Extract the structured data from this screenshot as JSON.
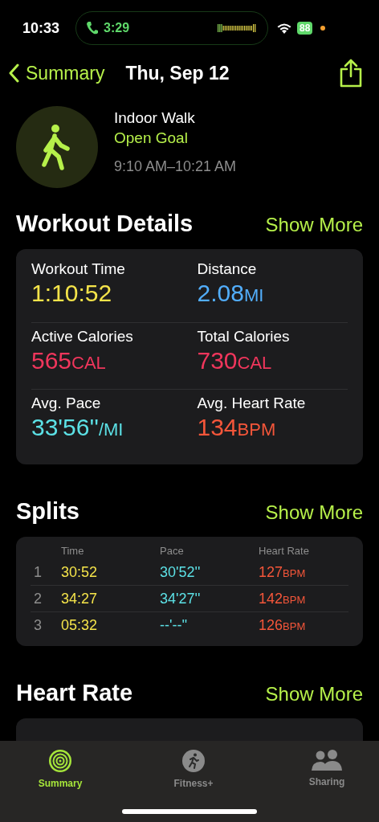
{
  "status_bar": {
    "time": "10:33",
    "call_time": "3:29",
    "battery": "88"
  },
  "nav": {
    "back": "Summary",
    "title": "Thu, Sep 12"
  },
  "workout": {
    "name": "Indoor Walk",
    "goal": "Open Goal",
    "time_range": "9:10 AM–10:21 AM"
  },
  "details": {
    "heading": "Workout Details",
    "more": "Show More",
    "stats": [
      {
        "label": "Workout Time",
        "value": "1:10:52",
        "color": "#f5e44a"
      },
      {
        "label": "Distance",
        "value": "2.08",
        "unit": "MI",
        "color": "#52aefc"
      },
      {
        "label": "Active Calories",
        "value": "565",
        "unit": "CAL",
        "color": "#f0365c"
      },
      {
        "label": "Total Calories",
        "value": "730",
        "unit": "CAL",
        "color": "#f0365c"
      },
      {
        "label": "Avg. Pace",
        "value": "33'56''",
        "unit": "/MI",
        "color": "#5ce1e6"
      },
      {
        "label": "Avg. Heart Rate",
        "value": "134",
        "unit": "BPM",
        "color": "#f5563a"
      }
    ]
  },
  "splits": {
    "heading": "Splits",
    "more": "Show More",
    "columns": [
      "Time",
      "Pace",
      "Heart Rate"
    ],
    "rows": [
      {
        "index": "1",
        "time": "30:52",
        "pace": "30'52''",
        "heart_rate": "127",
        "unit": "BPM"
      },
      {
        "index": "2",
        "time": "34:27",
        "pace": "34'27''",
        "heart_rate": "142",
        "unit": "BPM"
      },
      {
        "index": "3",
        "time": "05:32",
        "pace": "--'--''",
        "heart_rate": "126",
        "unit": "BPM"
      }
    ]
  },
  "heart_rate": {
    "heading": "Heart Rate",
    "more": "Show More"
  },
  "tab_bar": [
    {
      "label": "Summary",
      "kind": "rings",
      "selected": true
    },
    {
      "label": "Fitness+",
      "kind": "runner",
      "selected": false
    },
    {
      "label": "Sharing",
      "kind": "people",
      "selected": false
    }
  ]
}
